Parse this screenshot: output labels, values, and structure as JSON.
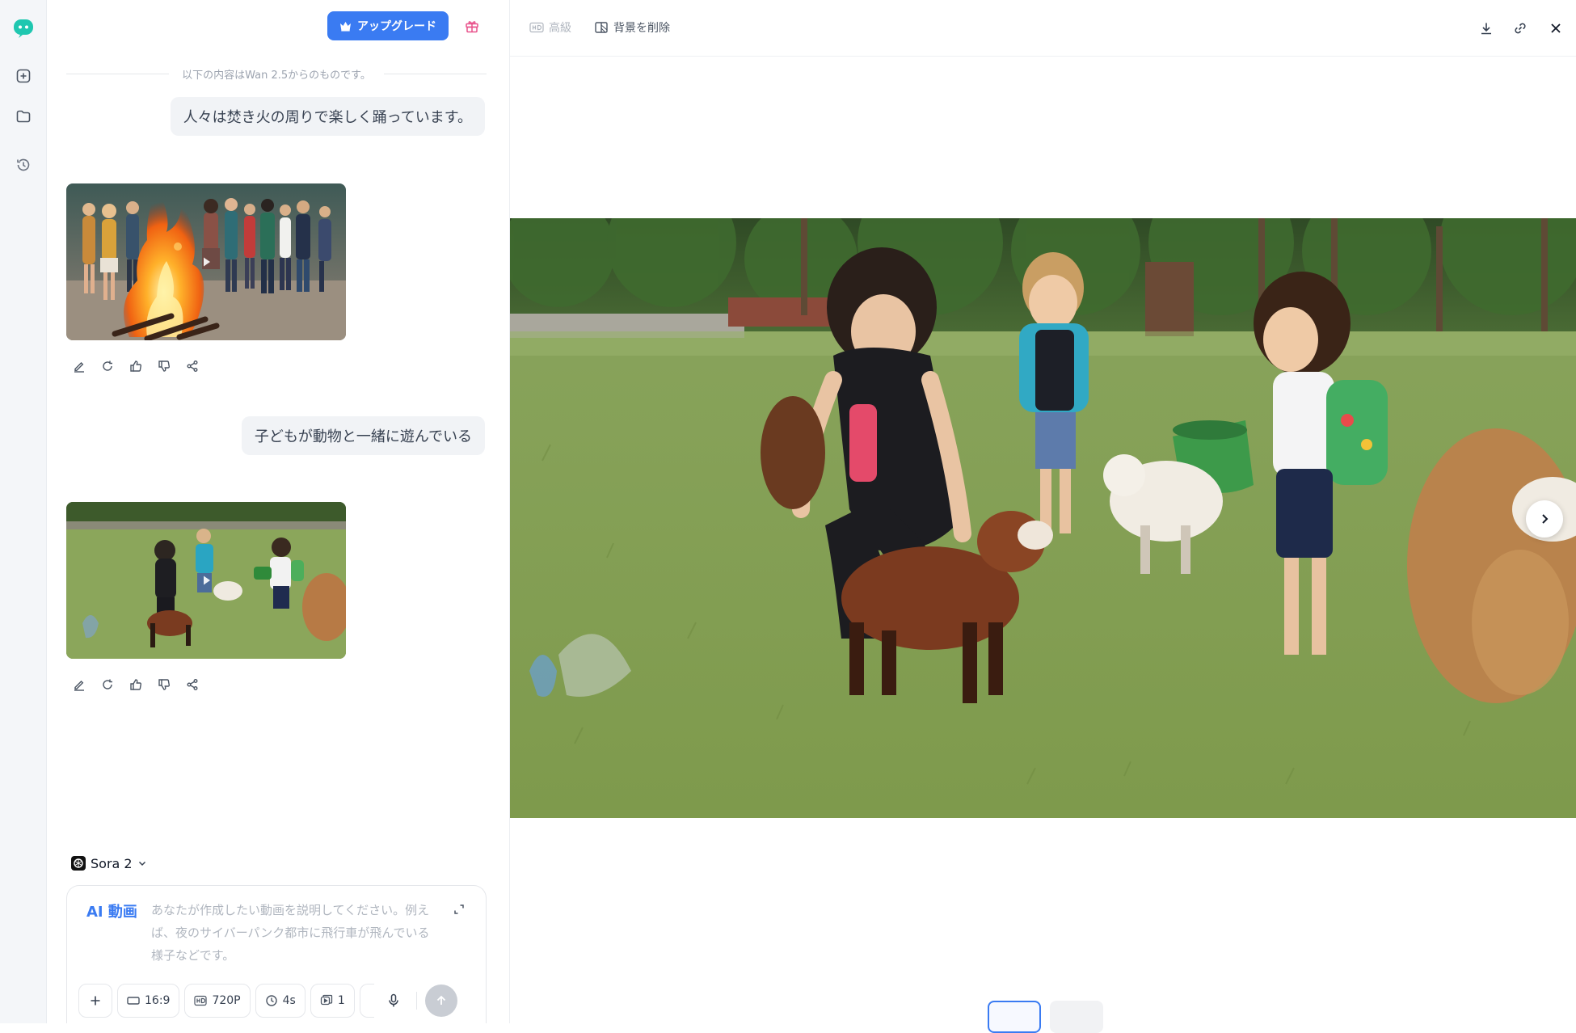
{
  "sidebar": {
    "logo_icon": "chat-bot-logo",
    "items": [
      {
        "icon": "new-chat-icon"
      },
      {
        "icon": "folder-icon"
      },
      {
        "icon": "history-icon"
      }
    ]
  },
  "header": {
    "upgrade_label": "アップグレード",
    "upgrade_icon": "crown-icon",
    "gift_icon": "gift-icon",
    "accent": "#3a7bf2"
  },
  "chat": {
    "source_note": "以下の内容はWan 2.5からのものです。",
    "messages": [
      {
        "role": "user",
        "text": "人々は焚き火の周りで楽しく踊っています。"
      },
      {
        "role": "assistant",
        "media": "video",
        "subject": "bonfire dancing"
      },
      {
        "role": "user",
        "text": "子どもが動物と一緒に遊んでいる"
      },
      {
        "role": "assistant",
        "media": "video",
        "subject": "children with goats"
      }
    ],
    "actions": [
      "edit-icon",
      "regenerate-icon",
      "thumbs-up-icon",
      "thumbs-down-icon",
      "share-icon"
    ]
  },
  "composer": {
    "model_name": "Sora 2",
    "mode_label": "AI 動画",
    "placeholder": "あなたが作成したい動画を説明してください。例えば、夜のサイバーパンク都市に飛行車が飛んでいる様子などです。",
    "aspect_ratio": "16:9",
    "resolution": "720P",
    "duration": "4s",
    "count": "1"
  },
  "viewer": {
    "hd_label": "高級",
    "remove_bg_label": "背景を削除",
    "toolbar_icons": [
      "download-icon",
      "link-icon",
      "close-icon"
    ]
  }
}
